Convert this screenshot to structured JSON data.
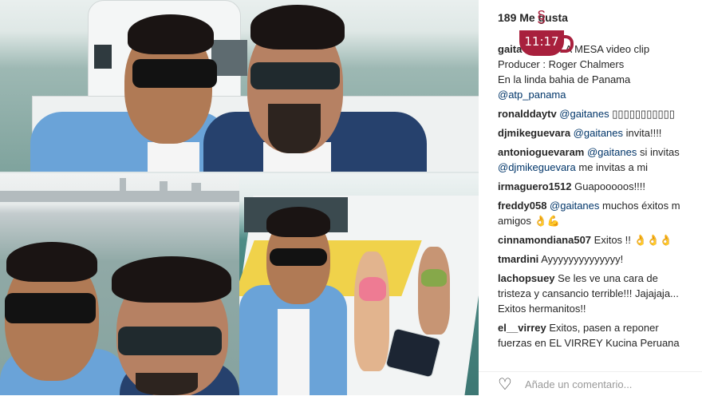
{
  "post": {
    "likes": "189 Me gusta",
    "time_overlay": "11:17"
  },
  "comments": [
    {
      "lines": [
        [
          {
            "t": "gaita",
            "k": "user"
          },
          {
            "t": "     mando LA MESA video clip",
            "k": "text"
          }
        ],
        [
          {
            "t": "Producer : Roger Chalmers",
            "k": "text"
          }
        ],
        [
          {
            "t": "En la linda bahia de Panama",
            "k": "text"
          }
        ],
        [
          {
            "t": "@atp_panama",
            "k": "mention"
          }
        ]
      ]
    },
    {
      "lines": [
        [
          {
            "t": "ronalddaytv",
            "k": "user"
          },
          {
            "t": " @gaitanes",
            "k": "mention"
          },
          {
            "t": " ▯▯▯▯▯▯▯▯▯▯▯",
            "k": "text"
          }
        ]
      ]
    },
    {
      "lines": [
        [
          {
            "t": "djmikeguevara",
            "k": "user"
          },
          {
            "t": " @gaitanes",
            "k": "mention"
          },
          {
            "t": " invita!!!!",
            "k": "text"
          }
        ]
      ]
    },
    {
      "lines": [
        [
          {
            "t": "antonioguevaram",
            "k": "user"
          },
          {
            "t": " @gaitanes",
            "k": "mention"
          },
          {
            "t": " si invitas",
            "k": "text"
          }
        ],
        [
          {
            "t": "@djmikeguevara",
            "k": "mention"
          },
          {
            "t": " me invitas a mi",
            "k": "text"
          }
        ]
      ]
    },
    {
      "lines": [
        [
          {
            "t": "irmaguero1512",
            "k": "user"
          },
          {
            "t": " Guapooooos!!!!",
            "k": "text"
          }
        ]
      ]
    },
    {
      "lines": [
        [
          {
            "t": "freddy058",
            "k": "user"
          },
          {
            "t": " @gaitanes",
            "k": "mention"
          },
          {
            "t": " muchos éxitos m",
            "k": "text"
          }
        ],
        [
          {
            "t": "amigos 👌💪",
            "k": "text"
          }
        ]
      ]
    },
    {
      "lines": [
        [
          {
            "t": "cinnamondiana507",
            "k": "user"
          },
          {
            "t": " Exitos !! 👌👌👌",
            "k": "text"
          }
        ]
      ]
    },
    {
      "lines": [
        [
          {
            "t": "tmardini",
            "k": "user"
          },
          {
            "t": " Ayyyyyyyyyyyyyy!",
            "k": "text"
          }
        ]
      ]
    },
    {
      "lines": [
        [
          {
            "t": "lachopsuey",
            "k": "user"
          },
          {
            "t": " Se les ve una cara de",
            "k": "text"
          }
        ],
        [
          {
            "t": "tristeza y cansancio terrible!!! Jajajaja...",
            "k": "text"
          }
        ],
        [
          {
            "t": "Exitos hermanitos!!",
            "k": "text"
          }
        ]
      ]
    },
    {
      "lines": [
        [
          {
            "t": "el__virrey",
            "k": "user"
          },
          {
            "t": " Exitos, pasen a reponer",
            "k": "text"
          }
        ],
        [
          {
            "t": "fuerzas en EL VIRREY Kucina Peruana",
            "k": "text"
          }
        ]
      ]
    }
  ],
  "footer": {
    "placeholder": "Añade un comentario...",
    "heart_icon": "heart-outline-icon"
  },
  "colors": {
    "mention": "#003569",
    "overlay_cup": "#a8203d"
  }
}
